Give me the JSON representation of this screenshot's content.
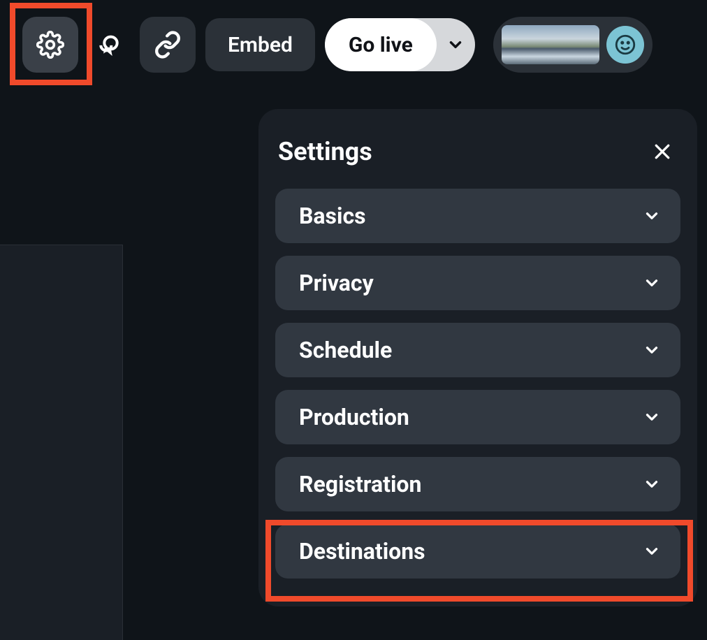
{
  "toolbar": {
    "embed_label": "Embed",
    "golive_label": "Go live"
  },
  "settings": {
    "title": "Settings",
    "items": [
      {
        "label": "Basics"
      },
      {
        "label": "Privacy"
      },
      {
        "label": "Schedule"
      },
      {
        "label": "Production"
      },
      {
        "label": "Registration"
      },
      {
        "label": "Destinations"
      }
    ]
  },
  "highlights": {
    "gear_selected": true,
    "destinations_selected": true
  }
}
